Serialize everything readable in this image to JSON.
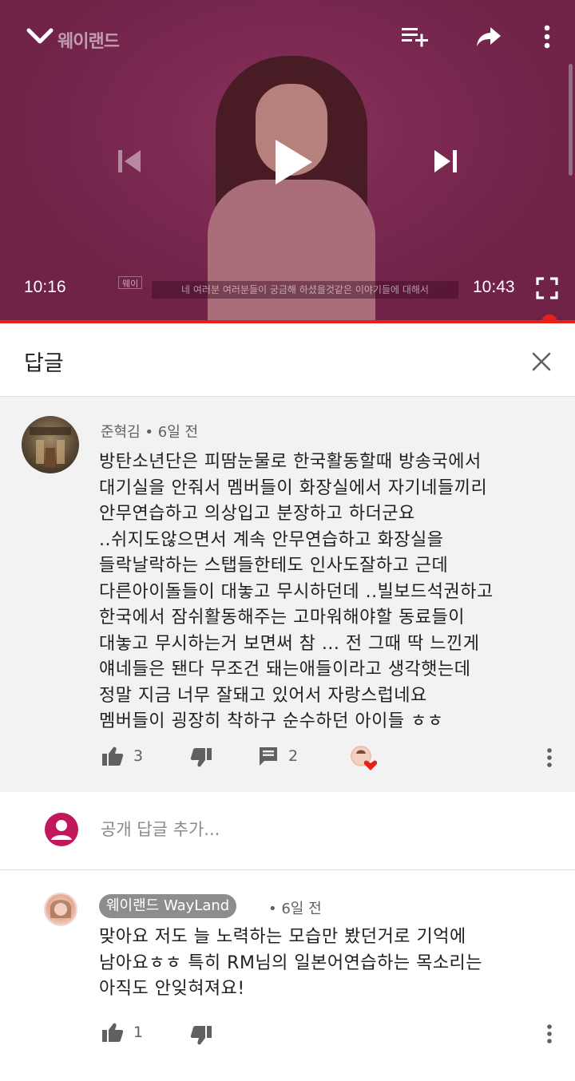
{
  "player": {
    "channel_logo": "웨이랜드",
    "current_time": "10:16",
    "total_time": "10:43",
    "subtitle_tag": "웨이",
    "subtitle": "네 여러분 여러분들이 궁금해 하셨을것같은 이야기들에 대해서",
    "progress": 0.956,
    "icons": [
      "chevron-down-icon",
      "add-to-queue-icon",
      "share-icon",
      "more-vert-icon",
      "skip-previous-icon",
      "play-icon",
      "skip-next-icon",
      "fullscreen-icon"
    ]
  },
  "replies_panel": {
    "title": "답글",
    "close_icon": "close-icon"
  },
  "parent_comment": {
    "author": "준혁김",
    "time": "6일 전",
    "text": "방탄소년단은 피땀눈물로 한국활동할때 방송국에서\n대기실을 안줘서 멤버들이 화장실에서 자기네들끼리\n안무연습하고 의상입고 분장하고 하더군요\n..쉬지도않으면서 계속 안무연습하고 화장실을\n들락날락하는 스탭들한테도 인사도잘하고 근데\n다른아이돌들이 대놓고 무시하던데 ..빌보드석권하고\n한국에서 잠쉬활동해주는 고마워해야할 동료들이\n대놓고 무시하는거 보면써 참 ... 전 그때 딱 느낀게\n얘네들은 됀다 무조건 돼는애들이라고 생각햇는데\n정말 지금 너무 잘돼고 있어서 자랑스럽네요\n멤버들이 굉장히 착하구 순수하던 아이들 ㅎㅎ",
    "likes": "3",
    "reply_count": "2"
  },
  "add_reply": {
    "placeholder": "공개 답글 추가..."
  },
  "reply": {
    "author": "웨이랜드 WayLand",
    "time": "6일 전",
    "text": "맞아요 저도 늘 노력하는 모습만 봤던거로 기억에\n남아요ㅎㅎ 특히 RM님의 일본어연습하는 목소리는\n아직도 안잊혀져요!",
    "likes": "1"
  },
  "colors": {
    "accent_red": "#e62117",
    "player_bg": "#842f5b",
    "comment_bg": "#f2f2f2",
    "author_chip": "#8d8d8d",
    "my_avatar": "#c2185b"
  }
}
